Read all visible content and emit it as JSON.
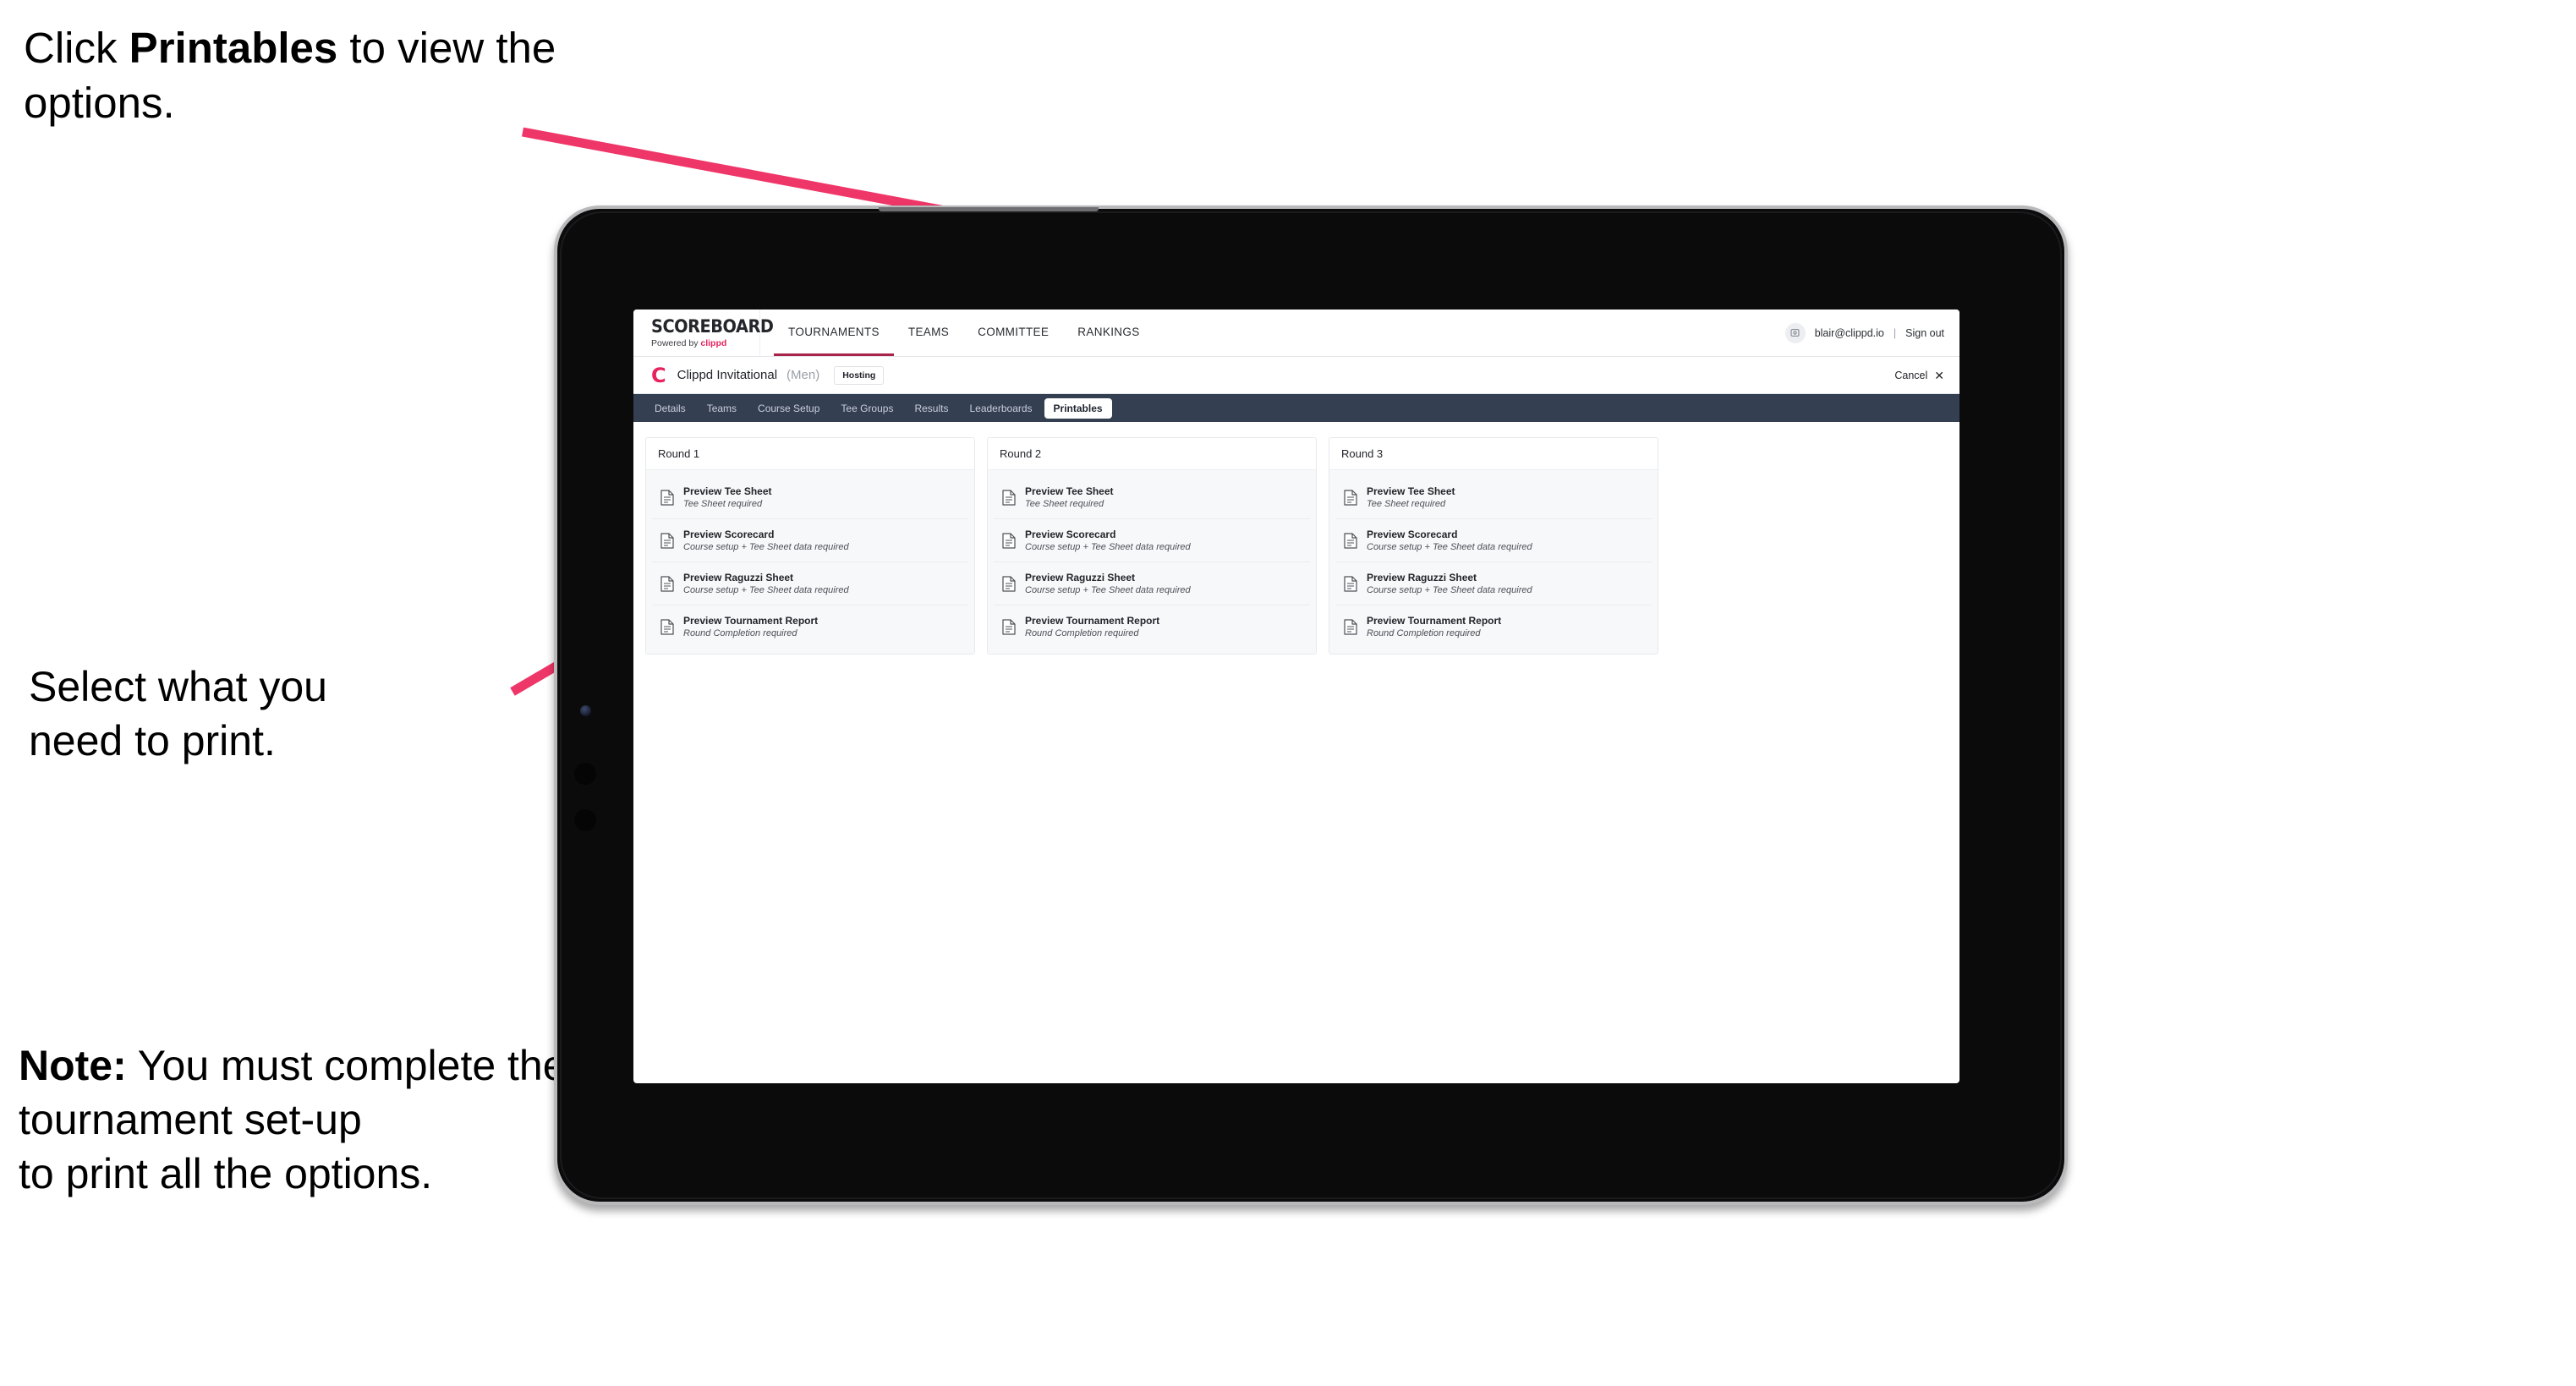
{
  "annotations": {
    "top": {
      "prefix": "Click ",
      "strong": "Printables",
      "suffix": " to view the options."
    },
    "middle": {
      "text": "Select what you\n need to print."
    },
    "note": {
      "label": "Note:",
      "text": " You must complete the tournament set-up\nto print all the options."
    }
  },
  "app": {
    "brand": {
      "title": "SCOREBOARD",
      "powered_prefix": "Powered by ",
      "powered_brand": "clippd"
    },
    "topnav": [
      {
        "label": "TOURNAMENTS",
        "active": true
      },
      {
        "label": "TEAMS",
        "active": false
      },
      {
        "label": "COMMITTEE",
        "active": false
      },
      {
        "label": "RANKINGS",
        "active": false
      }
    ],
    "account": {
      "avatar_icon": "user-avatar-icon",
      "email": "blair@clippd.io",
      "separator": "|",
      "sign_out": "Sign out"
    },
    "subheader": {
      "logo_letter": "C",
      "tournament_name": "Clippd Invitational",
      "gender": "(Men)",
      "badge": "Hosting",
      "cancel_label": "Cancel",
      "cancel_icon": "close-icon"
    },
    "tabs": [
      {
        "label": "Details",
        "active": false
      },
      {
        "label": "Teams",
        "active": false
      },
      {
        "label": "Course Setup",
        "active": false
      },
      {
        "label": "Tee Groups",
        "active": false
      },
      {
        "label": "Results",
        "active": false
      },
      {
        "label": "Leaderboards",
        "active": false
      },
      {
        "label": "Printables",
        "active": true
      }
    ],
    "rounds": [
      {
        "title": "Round 1",
        "items": [
          {
            "title": "Preview Tee Sheet",
            "sub": "Tee Sheet required"
          },
          {
            "title": "Preview Scorecard",
            "sub": "Course setup + Tee Sheet data required"
          },
          {
            "title": "Preview Raguzzi Sheet",
            "sub": "Course setup + Tee Sheet data required"
          },
          {
            "title": "Preview Tournament Report",
            "sub": "Round Completion required"
          }
        ]
      },
      {
        "title": "Round 2",
        "items": [
          {
            "title": "Preview Tee Sheet",
            "sub": "Tee Sheet required"
          },
          {
            "title": "Preview Scorecard",
            "sub": "Course setup + Tee Sheet data required"
          },
          {
            "title": "Preview Raguzzi Sheet",
            "sub": "Course setup + Tee Sheet data required"
          },
          {
            "title": "Preview Tournament Report",
            "sub": "Round Completion required"
          }
        ]
      },
      {
        "title": "Round 3",
        "items": [
          {
            "title": "Preview Tee Sheet",
            "sub": "Tee Sheet required"
          },
          {
            "title": "Preview Scorecard",
            "sub": "Course setup + Tee Sheet data required"
          },
          {
            "title": "Preview Raguzzi Sheet",
            "sub": "Course setup + Tee Sheet data required"
          },
          {
            "title": "Preview Tournament Report",
            "sub": "Round Completion required"
          }
        ]
      }
    ]
  },
  "colors": {
    "arrow": "#ef3668",
    "brand_pink": "#e8225c",
    "tabstrip": "#343f52",
    "active_tab_underline": "#a9224a"
  },
  "device": {
    "camera_icon": "camera-icon",
    "side_button_1": "volume-up-button",
    "side_button_2": "volume-down-button"
  }
}
